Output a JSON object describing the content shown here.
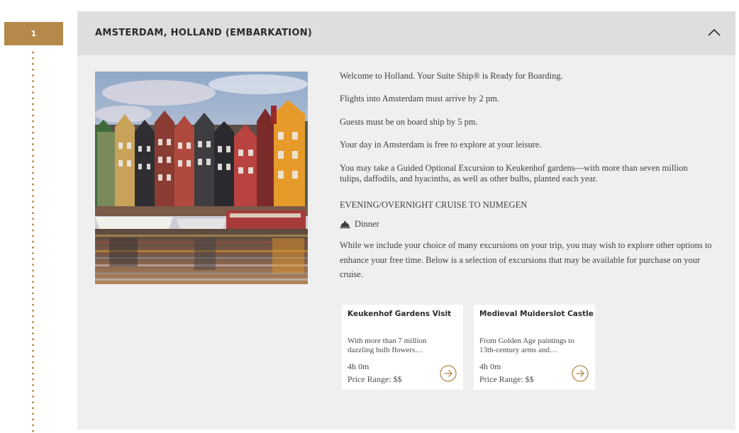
{
  "itinerary": {
    "day_number": "1"
  },
  "day": {
    "title": "AMSTERDAM, HOLLAND (EMBARKATION)",
    "hero_image": "amsterdam-canal-houses-photo",
    "paragraphs": [
      "Welcome to Holland. Your Suite Ship® is Ready for Boarding.",
      "Flights into Amsterdam must arrive by 2 pm.",
      "Guests must be on board ship by 5 pm.",
      "Your day in Amsterdam is free to explore at your leisure.",
      "You may take a Guided Optional Excursion to Keukenhof gardens—with more than seven million tulips, daffodils, and hyacinths, as well as other bulbs, planted each year."
    ],
    "evening": "EVENING/OVERNIGHT CRUISE TO NIJMEGEN",
    "meal": {
      "icon": "cloche-icon",
      "label": "Dinner"
    },
    "excursion_intro": "While we include your choice of many excursions on your trip, you may wish to explore other options to enhance your free time. Below is a selection of excursions that may be available for purchase on your cruise.",
    "excursions": [
      {
        "title": "Keukenhof Gardens Visit",
        "description": "With more than 7 million dazzling bulb flowers…",
        "duration": "4h 0m",
        "price": "Price Range:  $$"
      },
      {
        "title": "Medieval Muiderslot Castle",
        "description": "From Golden Age paintings to 13th-century arms and…",
        "duration": "4h 0m",
        "price": "Price Range:  $$"
      }
    ]
  },
  "colors": {
    "accent": "#b5894a",
    "card_background": "#efefef",
    "header_background": "#dedede"
  }
}
